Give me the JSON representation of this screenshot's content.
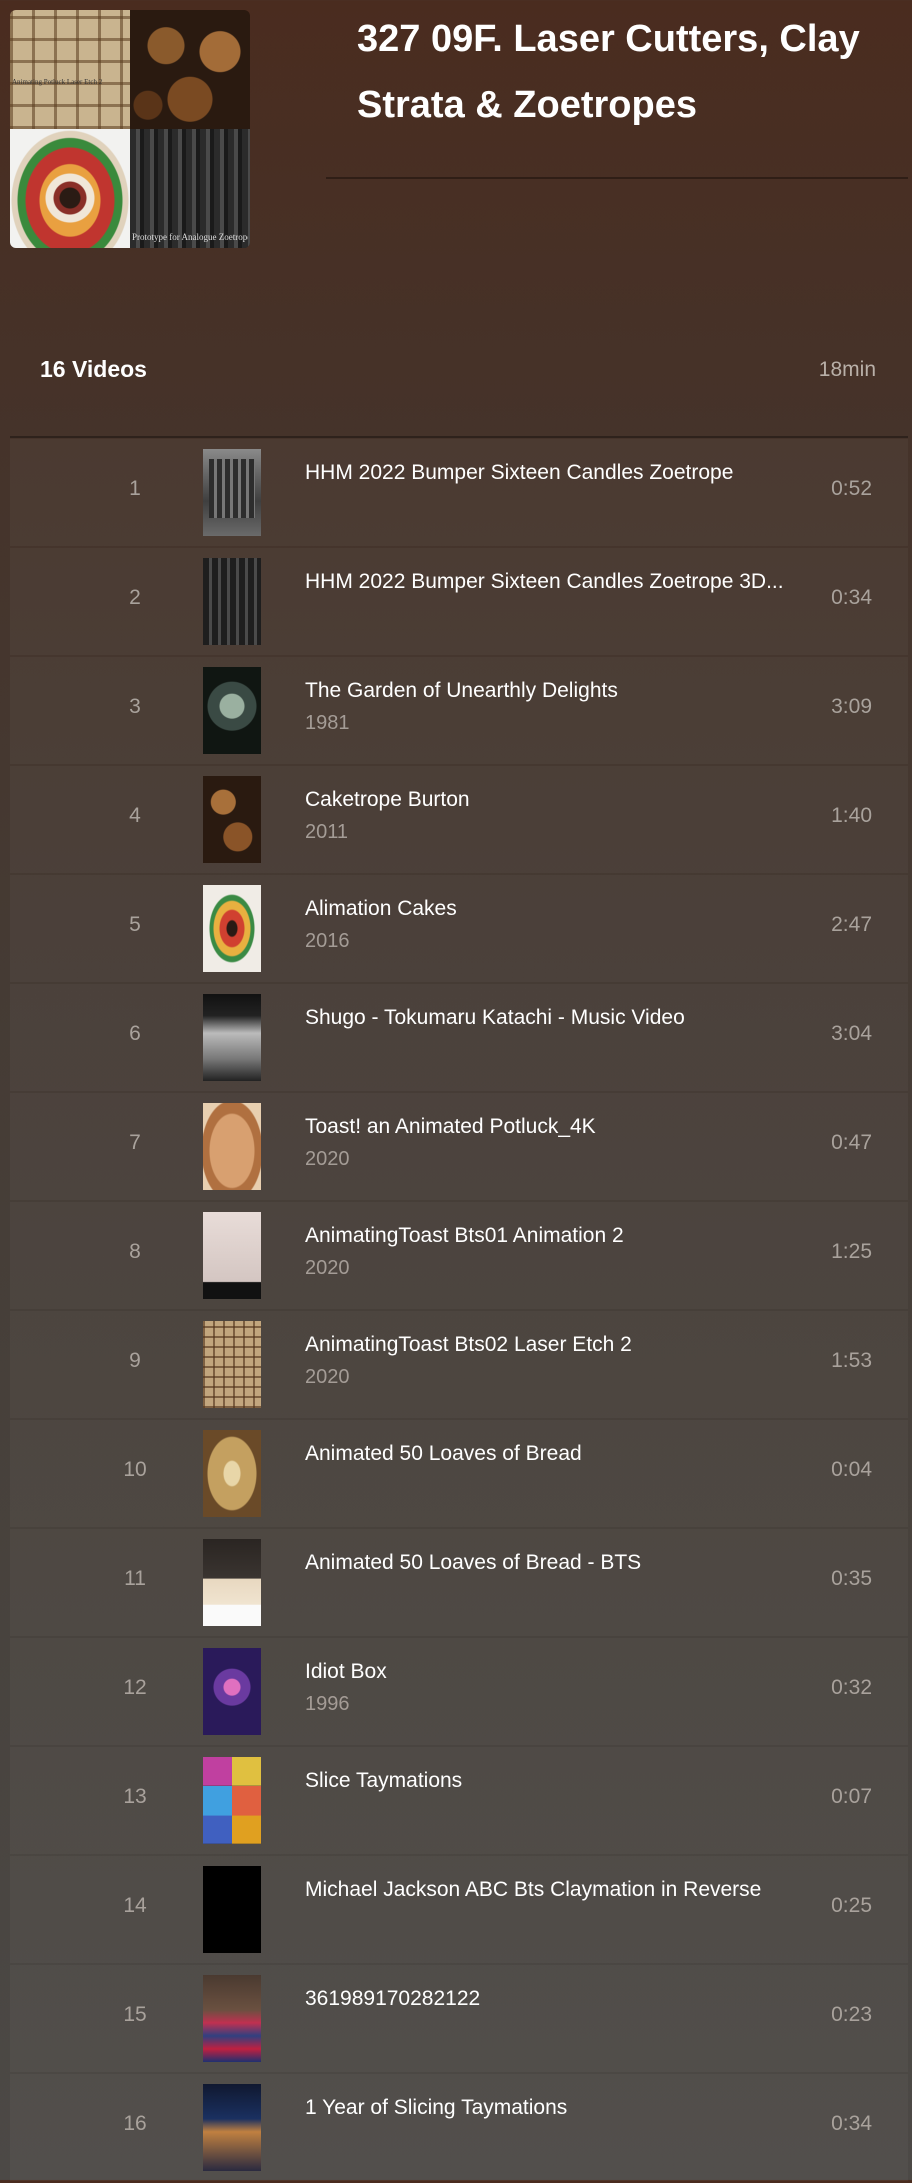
{
  "playlist": {
    "title": "327 09F. Laser Cutters, Clay Strata & Zoetropes",
    "cover_captions": {
      "top_left": "Animating Potluck Laser Etch 2",
      "bottom_right": "Prototype for Analogue Zoetrope C"
    },
    "video_count": "16 Videos",
    "total_duration": "18min"
  },
  "videos": [
    {
      "num": "1",
      "title": "HHM 2022 Bumper Sixteen Candles Zoetrope",
      "year": "",
      "duration": "0:52",
      "thumb_icon": "building-thumbnail"
    },
    {
      "num": "2",
      "title": "HHM 2022 Bumper Sixteen Candles Zoetrope 3D...",
      "year": "",
      "duration": "0:34",
      "thumb_icon": "zoetrope-prototype-thumbnail"
    },
    {
      "num": "3",
      "title": "The Garden of Unearthly Delights",
      "year": "1981",
      "duration": "3:09",
      "thumb_icon": "garden-thumbnail"
    },
    {
      "num": "4",
      "title": "Caketrope Burton",
      "year": "2011",
      "duration": "1:40",
      "thumb_icon": "cookies-thumbnail"
    },
    {
      "num": "5",
      "title": "Alimation Cakes",
      "year": "2016",
      "duration": "2:47",
      "thumb_icon": "cake-thumbnail"
    },
    {
      "num": "6",
      "title": "Shugo - Tokumaru Katachi - Music Video",
      "year": "",
      "duration": "3:04",
      "thumb_icon": "paper-sculpture-thumbnail"
    },
    {
      "num": "7",
      "title": "Toast! an Animated Potluck_4K",
      "year": "2020",
      "duration": "0:47",
      "thumb_icon": "toast-thumbnail"
    },
    {
      "num": "8",
      "title": "AnimatingToast Bts01 Animation 2",
      "year": "2020",
      "duration": "1:25",
      "thumb_icon": "sketch-thumbnail"
    },
    {
      "num": "9",
      "title": "AnimatingToast Bts02 Laser Etch 2",
      "year": "2020",
      "duration": "1:53",
      "thumb_icon": "laser-etch-thumbnail"
    },
    {
      "num": "10",
      "title": "Animated 50 Loaves of Bread",
      "year": "",
      "duration": "0:04",
      "thumb_icon": "bread-thumbnail"
    },
    {
      "num": "11",
      "title": "Animated 50 Loaves of Bread - BTS",
      "year": "",
      "duration": "0:35",
      "thumb_icon": "dough-thumbnail"
    },
    {
      "num": "12",
      "title": "Idiot Box",
      "year": "1996",
      "duration": "0:32",
      "thumb_icon": "psychedelic-face-thumbnail"
    },
    {
      "num": "13",
      "title": "Slice Taymations",
      "year": "",
      "duration": "0:07",
      "thumb_icon": "slices-grid-thumbnail"
    },
    {
      "num": "14",
      "title": "Michael Jackson ABC Bts Claymation in Reverse",
      "year": "",
      "duration": "0:25",
      "thumb_icon": "black-thumbnail"
    },
    {
      "num": "15",
      "title": "361989170282122",
      "year": "",
      "duration": "0:23",
      "thumb_icon": "striped-rug-thumbnail"
    },
    {
      "num": "16",
      "title": "1 Year of Slicing Taymations",
      "year": "",
      "duration": "0:34",
      "thumb_icon": "night-scene-thumbnail"
    }
  ]
}
